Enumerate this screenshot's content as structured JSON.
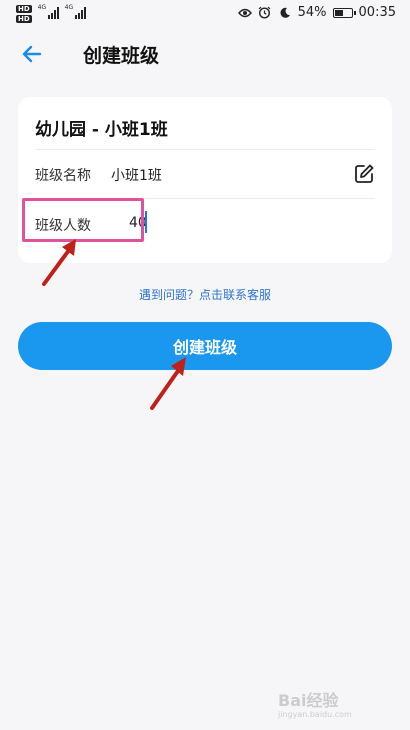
{
  "status_bar": {
    "sim1_label": "HD",
    "sim2_label": "HD",
    "net1_label": "4G",
    "net2_label": "4G",
    "battery_percent": "54%",
    "battery_level": 0.54,
    "time": "00:35",
    "icons": [
      "eye-icon",
      "alarm-icon",
      "moon-icon",
      "battery-icon"
    ]
  },
  "header": {
    "title": "创建班级",
    "back_icon": "arrow-left-icon"
  },
  "card": {
    "class_title": "幼儿园 - 小班1班",
    "name_label": "班级名称",
    "name_value": "小班1班",
    "count_label": "班级人数",
    "count_value": "40"
  },
  "help_link": "遇到问题？点击联系客服",
  "create_button": "创建班级",
  "watermark": {
    "text": "Bai经验",
    "url": "jingyan.baidu.com"
  },
  "colors": {
    "accent": "#1a97ef",
    "link": "#2d74c8",
    "highlight": "#e0539a",
    "annotation_arrow": "#c0201a"
  }
}
